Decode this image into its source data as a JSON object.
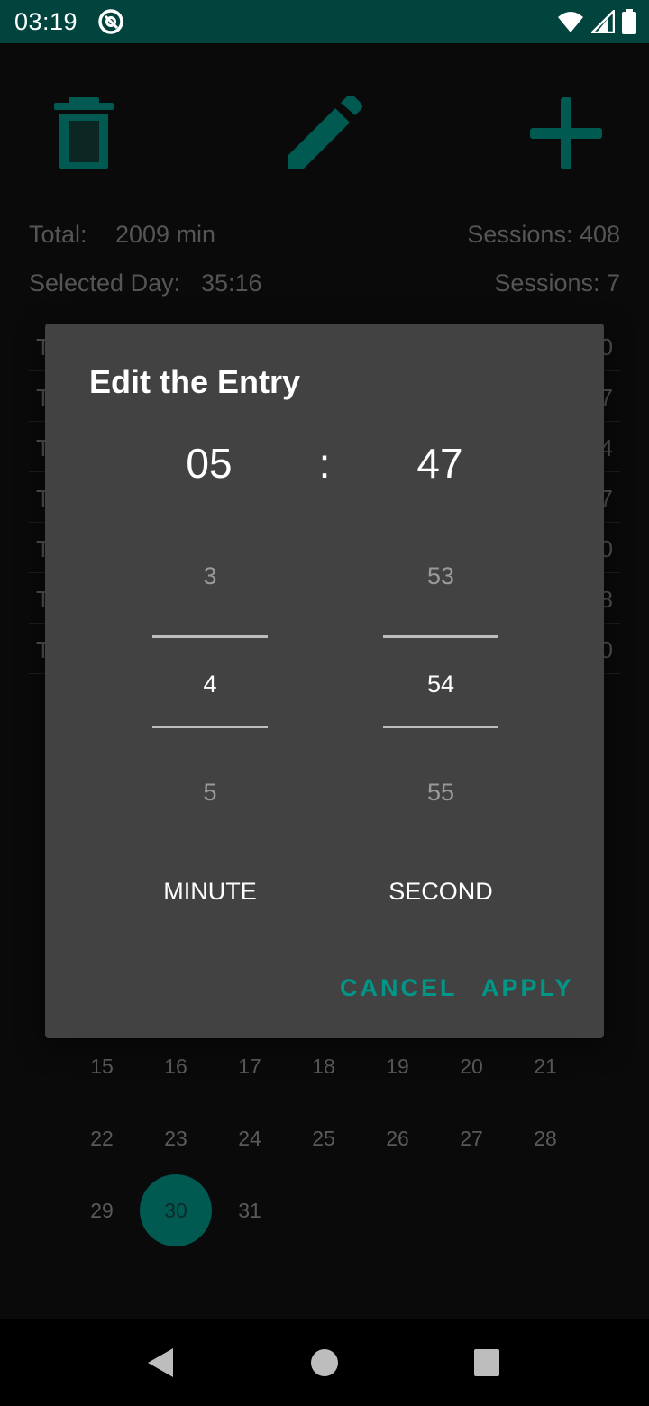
{
  "status_bar": {
    "time": "03:19",
    "app_icon": "at-sign-icon",
    "icons": [
      "wifi-icon",
      "signal-icon",
      "battery-icon"
    ]
  },
  "toolbar": {
    "delete_icon": "trash-icon",
    "edit_icon": "pencil-icon",
    "add_icon": "plus-icon",
    "accent_color": "#005a52"
  },
  "stats": {
    "total_label": "Total:",
    "total_value": "2009 min",
    "total_sessions": "Sessions: 408",
    "selected_label": "Selected Day:",
    "selected_value": "35:16",
    "selected_sessions": "Sessions: 7"
  },
  "list": {
    "rows": [
      {
        "left": "T",
        "right": "0"
      },
      {
        "left": "T",
        "right": "7"
      },
      {
        "left": "T",
        "right": "4"
      },
      {
        "left": "T",
        "right": "7"
      },
      {
        "left": "T",
        "right": "0"
      },
      {
        "left": "T",
        "right": "8"
      },
      {
        "left": "T",
        "right": "0"
      }
    ]
  },
  "calendar": {
    "rows": [
      [
        "15",
        "16",
        "17",
        "18",
        "19",
        "20",
        "21"
      ],
      [
        "22",
        "23",
        "24",
        "25",
        "26",
        "27",
        "28"
      ],
      [
        "29",
        "30",
        "31"
      ]
    ],
    "selected_day": "30"
  },
  "dialog": {
    "title": "Edit the Entry",
    "minutes_display": "05",
    "separator": ":",
    "seconds_display": "47",
    "minute_picker": {
      "prev": "3",
      "current": "4",
      "next": "5"
    },
    "second_picker": {
      "prev": "53",
      "current": "54",
      "next": "55"
    },
    "minute_caption": "MINUTE",
    "second_caption": "SECOND",
    "cancel_label": "CANCEL",
    "apply_label": "APPLY",
    "button_color": "#009688"
  },
  "nav_bar": {
    "back_icon": "back-triangle-icon",
    "home_icon": "home-circle-icon",
    "recents_icon": "recents-square-icon"
  }
}
